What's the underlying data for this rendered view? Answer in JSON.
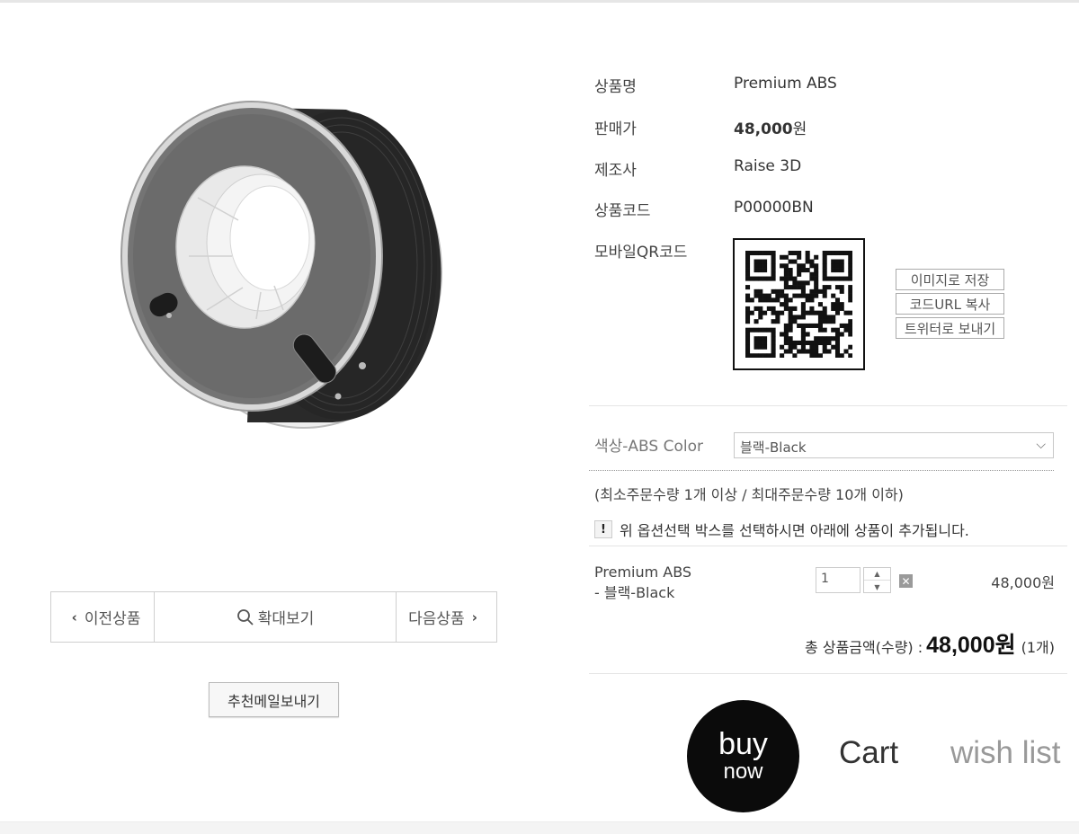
{
  "gallery": {
    "prev_label": "이전상품",
    "zoom_label": "확대보기",
    "next_label": "다음상품",
    "mail_label": "추천메일보내기"
  },
  "info": {
    "name_label": "상품명",
    "name_value": "Premium ABS",
    "price_label": "판매가",
    "price_number": "48,000",
    "price_unit": "원",
    "maker_label": "제조사",
    "maker_value": "Raise 3D",
    "code_label": "상품코드",
    "code_value": "P00000BN",
    "qr_label": "모바일QR코드"
  },
  "qr_buttons": [
    "이미지로 저장",
    "코드URL 복사",
    "트위터로 보내기"
  ],
  "option": {
    "label": "색상-ABS Color",
    "selected": "블랙-Black"
  },
  "quantity_note": "(최소주문수량 1개 이상 / 최대주문수량 10개 이하)",
  "notice": {
    "icon": "!",
    "text": "위 옵션선택 박스를 선택하시면 아래에 상품이 추가됩니다."
  },
  "line_item": {
    "name": "Premium ABS",
    "option": "- 블랙-Black",
    "quantity": "1",
    "price": "48,000원"
  },
  "total": {
    "label": "총 상품금액(수량) :",
    "amount": "48,000원",
    "count": "(1개)"
  },
  "actions": {
    "buy_line1": "buy",
    "buy_line2": "now",
    "cart": "Cart",
    "wish": "wish list"
  },
  "colors": {
    "filament": "#2e2e2e",
    "buy_bg": "#0b0b0b",
    "wish_text": "#999999"
  }
}
